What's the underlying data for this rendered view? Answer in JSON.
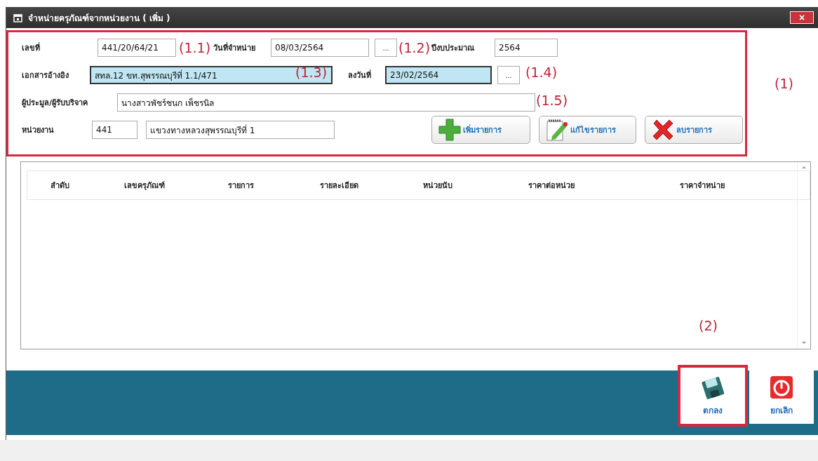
{
  "window": {
    "title": "จำหน่ายครุภัณฑ์จากหน่วยงาน ( เพิ่ม )",
    "close": "×"
  },
  "form": {
    "fields": [
      {
        "label": "เลขที่",
        "value": "441/20/64/21",
        "highlighted": false
      },
      {
        "label": "วันที่จำหน่าย",
        "value": "08/03/2564",
        "highlighted": false,
        "picker": "..."
      },
      {
        "label": "ปีงบประมาณ",
        "value": "2564",
        "highlighted": false
      },
      {
        "label": "เอกสารอ้างอิง",
        "value": "สทล.12 ขท.สุพรรณบุรีที่ 1.1/471",
        "highlighted": true
      },
      {
        "label": "ลงวันที่",
        "value": "23/02/2564",
        "highlighted": true,
        "picker": "..."
      },
      {
        "label": "ผู้ประมูล/ผู้รับบริจาค",
        "value": "นางสาวพัชร์ชนก เพ็ชรนิล",
        "highlighted": false
      },
      {
        "label": "หน่วยงาน",
        "value": "441",
        "value_2": "แขวงทางหลวงสุพรรณบุรีที่ 1",
        "highlighted": false
      }
    ],
    "buttons": [
      {
        "label": "เพิ่มรายการ",
        "kind": "add"
      },
      {
        "label": "แก้ไขรายการ",
        "kind": "edit"
      },
      {
        "label": "ลบรายการ",
        "kind": "delete"
      }
    ]
  },
  "table": {
    "columns": [
      "ลำดับ",
      "เลขครุภัณฑ์",
      "รายการ",
      "รายละเอียด",
      "หน่วยนับ",
      "ราคาต่อหน่วย",
      "ราคาจำหน่าย"
    ]
  },
  "actions": [
    {
      "label": "ตกลง",
      "kind": "save"
    },
    {
      "label": "ยกเลิก",
      "kind": "cancel"
    }
  ],
  "annotations": [
    {
      "label": "(1.1)"
    },
    {
      "label": "(1.2)"
    },
    {
      "label": "(1.3)"
    },
    {
      "label": "(1.4)"
    },
    {
      "label": "(1.5)"
    },
    {
      "label": "(1)"
    },
    {
      "label": "(2)"
    }
  ]
}
